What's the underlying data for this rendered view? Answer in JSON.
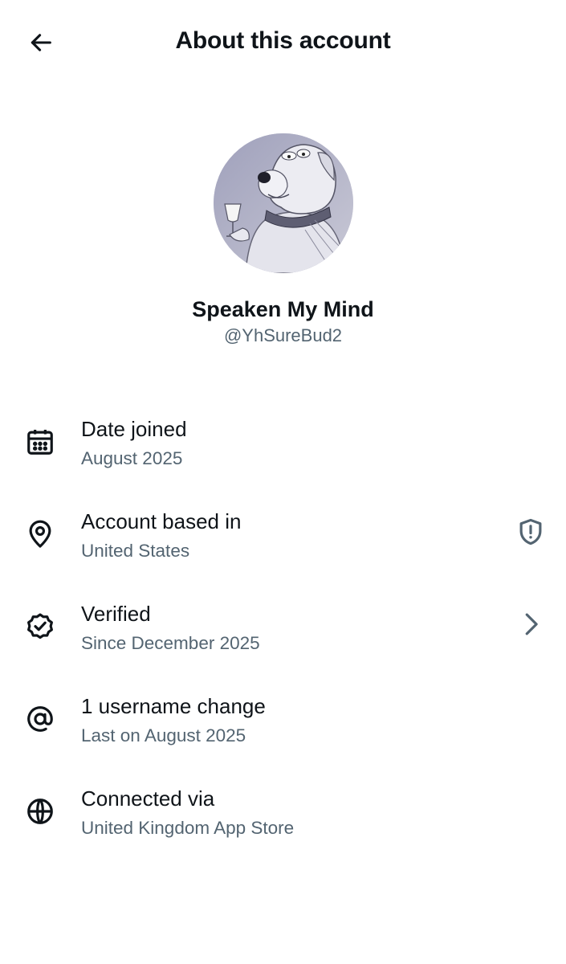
{
  "header": {
    "title": "About this account",
    "back_icon": "arrow-left-icon"
  },
  "profile": {
    "display_name": "Speaken My Mind",
    "handle": "@YhSureBud2"
  },
  "rows": [
    {
      "icon": "calendar-icon",
      "title": "Date joined",
      "subtitle": "August 2025"
    },
    {
      "icon": "location-pin-icon",
      "title": "Account based in",
      "subtitle": "United States",
      "trailing_icon": "shield-alert-icon"
    },
    {
      "icon": "verified-badge-icon",
      "title": "Verified",
      "subtitle": "Since December 2025",
      "trailing_icon": "chevron-right-icon"
    },
    {
      "icon": "at-sign-icon",
      "title": "1 username change",
      "subtitle": "Last on August 2025"
    },
    {
      "icon": "globe-icon",
      "title": "Connected via",
      "subtitle": "United Kingdom App Store"
    }
  ],
  "colors": {
    "primary_text": "#0f1419",
    "secondary_text": "#536471",
    "background": "#ffffff"
  }
}
